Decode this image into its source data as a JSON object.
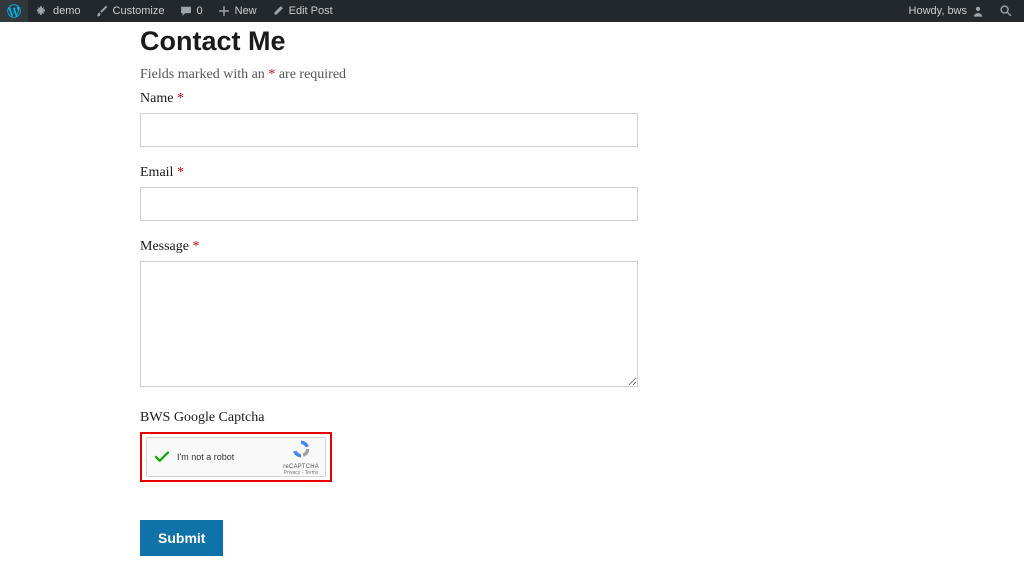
{
  "adminbar": {
    "site_name": "demo",
    "customize": "Customize",
    "comments_count": "0",
    "new": "New",
    "edit_post": "Edit Post",
    "howdy_prefix": "Howdy, ",
    "user": "bws"
  },
  "page": {
    "title": "Contact Me",
    "required_note_prefix": "Fields marked with an",
    "required_note_suffix": "are required",
    "asterisk": "*"
  },
  "form": {
    "name_label": "Name",
    "email_label": "Email",
    "message_label": "Message",
    "captcha_label": "BWS Google Captcha",
    "submit_label": "Submit",
    "name_value": "",
    "email_value": "",
    "message_value": ""
  },
  "recaptcha": {
    "text": "I'm not a robot",
    "brand": "reCAPTCHA",
    "links": "Privacy - Terms",
    "checked": true
  }
}
